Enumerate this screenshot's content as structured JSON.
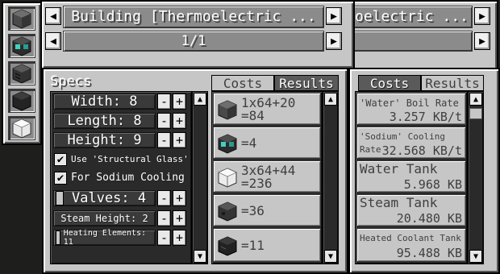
{
  "header": {
    "title": "Building [Thermoelectric ...",
    "page": "1/1",
    "second_title": "oelectric ..."
  },
  "specs": {
    "title": "Specs",
    "width": "Width: 8",
    "length": "Length: 8",
    "height": "Height: 9",
    "use_structural_glass": "Use 'Structural Glass'",
    "sodium_cooling": "For Sodium Cooling",
    "valves": "Valves: 4",
    "steam_height": "Steam Height: 2",
    "heating_elements": "Heating Elements: 11",
    "plus": "+",
    "minus": "-"
  },
  "tabs": {
    "costs": "Costs",
    "results": "Results"
  },
  "costs": [
    {
      "line1": "1x64+20",
      "line2": "=84",
      "icon": "casing-block-icon"
    },
    {
      "line1": "=4",
      "line2": "",
      "icon": "port-block-icon"
    },
    {
      "line1": "3x64+44",
      "line2": "=236",
      "icon": "structural-glass-icon"
    },
    {
      "line1": "=36",
      "line2": "",
      "icon": "pressure-disperser-icon"
    },
    {
      "line1": "=11",
      "line2": "",
      "icon": "heating-element-icon"
    }
  ],
  "results": [
    {
      "label": "'Water' Boil Rate",
      "value": "3.257 KB/t"
    },
    {
      "label": "'Sodium' Cooling Rate",
      "value": "32.568 KB/t"
    },
    {
      "label": "Water Tank",
      "value": "5.968 KB"
    },
    {
      "label": "Steam Tank",
      "value": "20.480 KB"
    },
    {
      "label": "Heated Coolant Tank",
      "value": "95.488 KB"
    }
  ],
  "sidebar_icons": [
    "casing-block-icon",
    "port-block-icon",
    "vent-block-icon",
    "dark-block-icon",
    "glass-block-icon"
  ],
  "colors": {
    "panel": "#c6c6c6",
    "bar": "#8b8b8b",
    "dark": "#3a3a3a",
    "background": "#1e1f1c"
  }
}
